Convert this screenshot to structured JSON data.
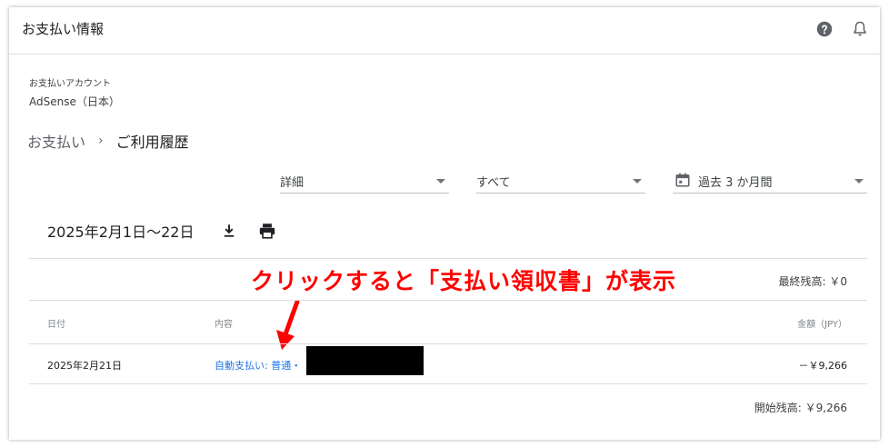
{
  "app": {
    "title": "お支払い情報"
  },
  "header_icons": {
    "help": "help-icon",
    "notifications": "bell-icon"
  },
  "account": {
    "label": "お支払いアカウント",
    "name": "AdSense（日本）"
  },
  "breadcrumb": {
    "parent": "お支払い",
    "separator": "›",
    "current": "ご利用履歴"
  },
  "filters": {
    "detail": "詳細",
    "type": "すべて",
    "range": "過去 3 か月間"
  },
  "period": {
    "label": "2025年2月1日〜22日"
  },
  "annotation": {
    "text": "クリックすると「支払い領収書」が表示",
    "color": "#ff0000"
  },
  "summary": {
    "final_balance": "最終残高: ￥0",
    "opening_balance": "開始残高: ￥9,266"
  },
  "table": {
    "headers": {
      "date": "日付",
      "description": "内容",
      "amount": "金額（JPY）"
    },
    "rows": [
      {
        "date": "2025年2月21日",
        "description": "自動支払い: 普通・",
        "amount": "－￥9,266"
      }
    ]
  },
  "colors": {
    "link": "#1a73e8",
    "annotation": "#ff0000",
    "divider": "#dadce0"
  }
}
